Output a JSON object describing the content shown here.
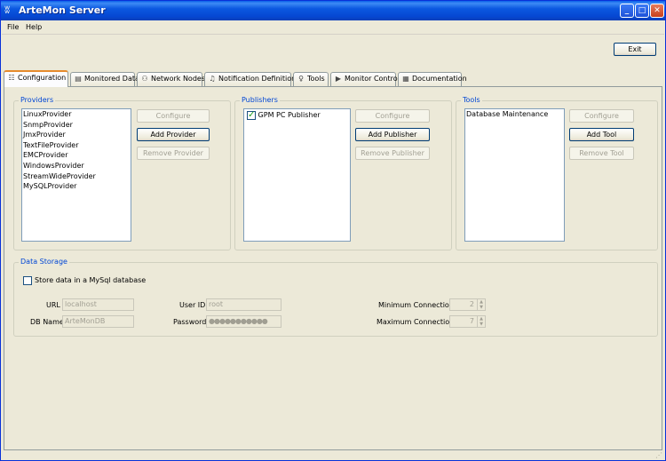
{
  "window": {
    "title": "ArteMon Server"
  },
  "titlebar_buttons": {
    "minimize": "_",
    "maximize": "□",
    "close": "✕"
  },
  "menu": {
    "file": "File",
    "help": "Help"
  },
  "toolbar": {
    "exit_label": "Exit"
  },
  "tabs": [
    {
      "label": "Configuration",
      "icon": "configuration-icon",
      "active": true
    },
    {
      "label": "Monitored Data",
      "icon": "clipboard-icon"
    },
    {
      "label": "Network Nodes",
      "icon": "network-icon"
    },
    {
      "label": "Notification Definitions",
      "icon": "bell-icon"
    },
    {
      "label": "Tools",
      "icon": "pin-icon"
    },
    {
      "label": "Monitor Control",
      "icon": "play-icon"
    },
    {
      "label": "Documentation",
      "icon": "document-icon"
    }
  ],
  "providers": {
    "title": "Providers",
    "items": [
      "LinuxProvider",
      "SnmpProvider",
      "JmxProvider",
      "TextFileProvider",
      "EMCProvider",
      "WindowsProvider",
      "StreamWideProvider",
      "MySQLProvider"
    ],
    "configure_label": "Configure",
    "add_label": "Add Provider",
    "remove_label": "Remove Provider"
  },
  "publishers": {
    "title": "Publishers",
    "items": [
      {
        "label": "GPM PC Publisher",
        "checked": true
      }
    ],
    "configure_label": "Configure",
    "add_label": "Add Publisher",
    "remove_label": "Remove Publisher"
  },
  "tools": {
    "title": "Tools",
    "items": [
      "Database Maintenance"
    ],
    "configure_label": "Configure",
    "add_label": "Add Tool",
    "remove_label": "Remove Tool"
  },
  "data_storage": {
    "title": "Data Storage",
    "store_checkbox_label": "Store data in a MySql database",
    "store_checked": false,
    "url_label": "URL",
    "url_value": "localhost",
    "dbname_label": "DB Name",
    "dbname_value": "ArteMonDB",
    "userid_label": "User ID",
    "userid_value": "root",
    "password_label": "Password",
    "password_value": "●●●●●●●●●●●",
    "min_conn_label": "Minimum Connections",
    "min_conn_value": "2",
    "max_conn_label": "Maximum Connections",
    "max_conn_value": "7"
  },
  "colors": {
    "title_blue": "#0a5fe8",
    "group_title": "#0046d5",
    "active_tab_accent": "#e68b2c"
  }
}
